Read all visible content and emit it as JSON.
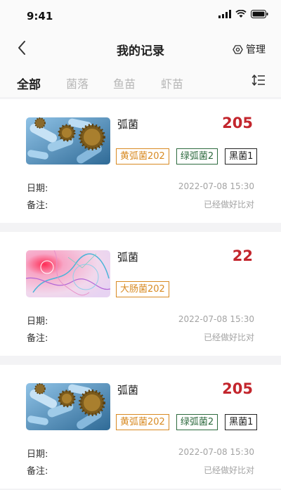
{
  "status": {
    "time": "9:41"
  },
  "nav": {
    "title": "我的记录",
    "manage_label": "管理"
  },
  "tabs": [
    {
      "label": "全部",
      "active": true
    },
    {
      "label": "菌落",
      "active": false
    },
    {
      "label": "鱼苗",
      "active": false
    },
    {
      "label": "虾苗",
      "active": false
    }
  ],
  "records": [
    {
      "title": "弧菌",
      "count": "205",
      "tags": [
        "黄弧菌202",
        "绿弧菌2",
        "黑菌1"
      ],
      "date_label": "日期:",
      "date_value": "2022-07-08   15:30",
      "note_label": "备注:",
      "note_value": "已经做好比对"
    },
    {
      "title": "弧菌",
      "count": "22",
      "tags": [
        "大肠菌202"
      ],
      "date_label": "日期:",
      "date_value": "2022-07-08   15:30",
      "note_label": "备注:",
      "note_value": "已经做好比对"
    },
    {
      "title": "弧菌",
      "count": "205",
      "tags": [
        "黄弧菌202",
        "绿弧菌2",
        "黑菌1"
      ],
      "date_label": "日期:",
      "date_value": "2022-07-08   15:30",
      "note_label": "备注:",
      "note_value": "已经做好比对"
    }
  ]
}
